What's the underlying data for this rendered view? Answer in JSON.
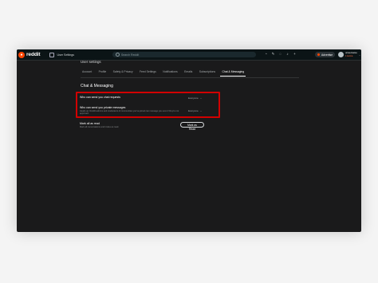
{
  "topbar": {
    "logo_text": "reddit",
    "breadcrumb": "User Settings",
    "search_placeholder": "Search Reddit",
    "advertise_label": "Advertise",
    "user_name": "u/username",
    "user_karma": "1 karma",
    "icons": [
      "popular-icon",
      "chat-icon",
      "create-post-icon",
      "notifications-icon",
      "add-icon"
    ]
  },
  "page": {
    "title": "User settings",
    "tabs": [
      "Account",
      "Profile",
      "Safety & Privacy",
      "Feed Settings",
      "Notifications",
      "Emails",
      "Subscriptions",
      "Chat & Messaging"
    ],
    "active_tab": "Chat & Messaging"
  },
  "chat": {
    "section_title": "Chat & Messaging",
    "rows": [
      {
        "title": "Who can send you chat requests",
        "value": "Everyone"
      },
      {
        "title": "Who can send you private messages",
        "desc": "Heads up: Reddit admins and moderators of communities you've joined can message you even if they're not approved.",
        "value": "Everyone"
      },
      {
        "title": "Mark all as read",
        "desc": "Mark all conversations and invites as read."
      }
    ],
    "mark_button": "Mark as Read"
  },
  "colors": {
    "accent": "#ff4500",
    "highlight": "#d10000",
    "background": "#1a1a1b"
  }
}
